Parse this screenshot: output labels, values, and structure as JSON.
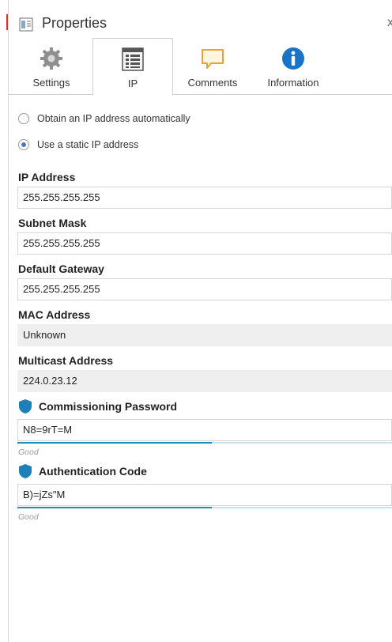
{
  "window": {
    "title": "Properties",
    "close_glyph": "x"
  },
  "tabs": [
    {
      "label": "Settings",
      "icon": "gear-icon"
    },
    {
      "label": "IP",
      "icon": "ip-list-icon",
      "active": true
    },
    {
      "label": "Comments",
      "icon": "comment-icon"
    },
    {
      "label": "Information",
      "icon": "info-icon"
    }
  ],
  "ip_mode": {
    "auto_label": "Obtain an IP address automatically",
    "static_label": "Use a static IP address",
    "selected": "static"
  },
  "fields": {
    "ip_address": {
      "label": "IP Address",
      "value": "255.255.255.255"
    },
    "subnet_mask": {
      "label": "Subnet Mask",
      "value": "255.255.255.255"
    },
    "default_gateway": {
      "label": "Default Gateway",
      "value": "255.255.255.255"
    },
    "mac_address": {
      "label": "MAC Address",
      "value": "Unknown"
    },
    "multicast_address": {
      "label": "Multicast Address",
      "value": "224.0.23.12"
    }
  },
  "security": {
    "commissioning_password": {
      "label": "Commissioning Password",
      "value": "N8=9rT=M",
      "strength_label": "Good",
      "strength": 0.52
    },
    "authentication_code": {
      "label": "Authentication Code",
      "value": "B)=jZs\"M",
      "strength_label": "Good",
      "strength": 0.52
    }
  },
  "colors": {
    "accent": "#1f8db5",
    "shield": "#1f7fb8",
    "info": "#1a73c6",
    "comment": "#f0a030"
  }
}
